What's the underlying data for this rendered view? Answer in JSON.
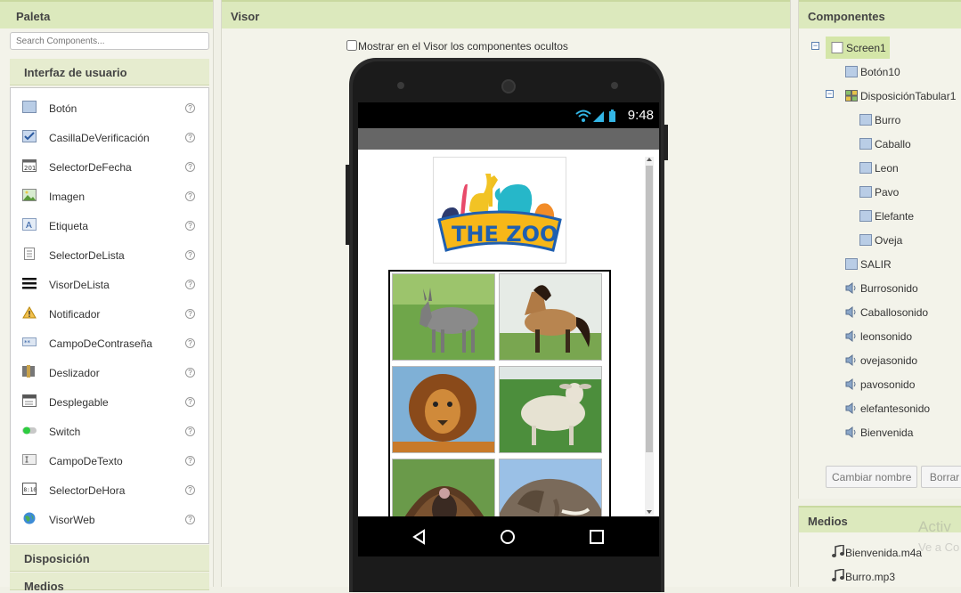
{
  "palette": {
    "title": "Paleta",
    "search_placeholder": "Search Components...",
    "section_ui": "Interfaz de usuario",
    "items": [
      {
        "label": "Botón",
        "help": "?"
      },
      {
        "label": "CasillaDeVerificación",
        "help": "?"
      },
      {
        "label": "SelectorDeFecha",
        "help": "?"
      },
      {
        "label": "Imagen",
        "help": "?"
      },
      {
        "label": "Etiqueta",
        "help": "?"
      },
      {
        "label": "SelectorDeLista",
        "help": "?"
      },
      {
        "label": "VisorDeLista",
        "help": "?"
      },
      {
        "label": "Notificador",
        "help": "?"
      },
      {
        "label": "CampoDeContraseña",
        "help": "?"
      },
      {
        "label": "Deslizador",
        "help": "?"
      },
      {
        "label": "Desplegable",
        "help": "?"
      },
      {
        "label": "Switch",
        "help": "?"
      },
      {
        "label": "CampoDeTexto",
        "help": "?"
      },
      {
        "label": "SelectorDeHora",
        "help": "?"
      },
      {
        "label": "VisorWeb",
        "help": "?"
      }
    ],
    "section_layout": "Disposición",
    "section_media": "Medios"
  },
  "viewer": {
    "title": "Visor",
    "show_hidden_label": "Mostrar en el Visor los componentes ocultos",
    "status_time": "9:48",
    "logo_text": "THE ZOO"
  },
  "components": {
    "title": "Componentes",
    "tree": [
      {
        "label": "Screen1"
      },
      {
        "label": "Botón10"
      },
      {
        "label": "DisposiciónTabular1"
      },
      {
        "label": "Burro"
      },
      {
        "label": "Caballo"
      },
      {
        "label": "Leon"
      },
      {
        "label": "Pavo"
      },
      {
        "label": "Elefante"
      },
      {
        "label": "Oveja"
      },
      {
        "label": "SALIR"
      },
      {
        "label": "Burrosonido"
      },
      {
        "label": "Caballosonido"
      },
      {
        "label": "leonsonido"
      },
      {
        "label": "ovejasonido"
      },
      {
        "label": "pavosonido"
      },
      {
        "label": "elefantesonido"
      },
      {
        "label": "Bienvenida"
      }
    ],
    "rename_button": "Cambiar nombre",
    "delete_button": "Borrar"
  },
  "media": {
    "title": "Medios",
    "files": [
      "Bienvenida.m4a",
      "Burro.mp3"
    ],
    "watermark_line1": "Activ",
    "watermark_line2": "Ve a Co"
  },
  "colors": {
    "header_green": "#dce9bd",
    "selected_green": "#d4e6a8",
    "phone_body": "#2a2a2a"
  }
}
